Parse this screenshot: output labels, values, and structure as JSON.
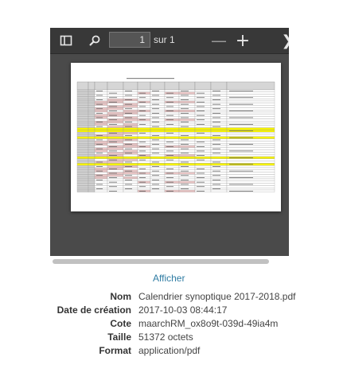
{
  "viewer": {
    "page_input": "1",
    "page_of": "sur 1",
    "icons": {
      "sidebar": "sidebar-toggle-icon",
      "search": "search-icon",
      "zoom_out": "minus-icon",
      "zoom_in": "plus-icon",
      "next": "chevron-right-icon"
    }
  },
  "link": {
    "label": "Afficher"
  },
  "info": {
    "rows": [
      {
        "label": "Nom",
        "value": "Calendrier synoptique 2017-2018.pdf"
      },
      {
        "label": "Date de création",
        "value": "2017-10-03 08:44:17"
      },
      {
        "label": "Cote",
        "value": "maarchRM_ox8o9t-039d-49ia4m"
      },
      {
        "label": "Taille",
        "value": "51372 octets"
      },
      {
        "label": "Format",
        "value": "application/pdf"
      }
    ]
  },
  "colors": {
    "accent_link": "#2f7ca3",
    "toolbar_bg": "#383838",
    "viewer_bg": "#4a4a4a",
    "table_highlight_yellow": "#f5f200",
    "table_highlight_pink": "#e8c4c4"
  }
}
